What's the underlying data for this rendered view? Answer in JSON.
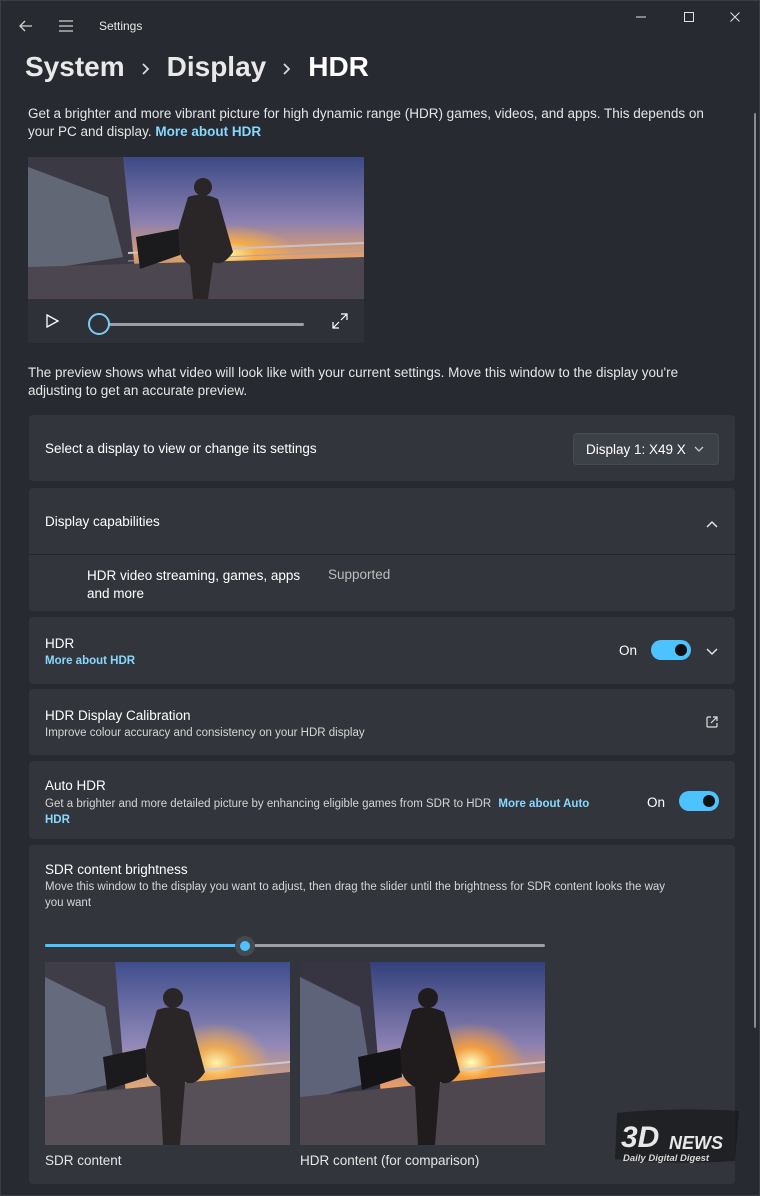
{
  "window": {
    "title": "Settings"
  },
  "breadcrumb": [
    "System",
    "Display",
    "HDR"
  ],
  "intro": {
    "text": "Get a brighter and more vibrant picture for high dynamic range (HDR) games, videos, and apps. This depends on your PC and display.",
    "link": "More about HDR"
  },
  "preview_note": "The preview shows what video will look like with your current settings. Move this window to the display you're adjusting to get an accurate preview.",
  "video": {
    "progress": 0
  },
  "display_select": {
    "label": "Select a display to view or change its settings",
    "value": "Display 1: X49 X"
  },
  "capabilities": {
    "title": "Display capabilities",
    "row_label_line1": "HDR video streaming, games, apps",
    "row_label_line2": "and more",
    "row_value": "Supported"
  },
  "hdr": {
    "title": "HDR",
    "link": "More about HDR",
    "state": "On"
  },
  "calibration": {
    "title": "HDR Display Calibration",
    "subtitle": "Improve colour accuracy and consistency on your HDR display"
  },
  "auto_hdr": {
    "title": "Auto HDR",
    "subtitle": "Get a brighter and more detailed picture by enhancing eligible games from SDR to HDR",
    "link_part1": "More about Auto",
    "link_part2": "HDR",
    "state": "On"
  },
  "sdr_brightness": {
    "title": "SDR content brightness",
    "subtitle_line1": "Move this window to the display you want to adjust, then drag the slider until the brightness for SDR content looks the way",
    "subtitle_line2": "you want",
    "level": 0.4,
    "caption_sdr": "SDR content",
    "caption_hdr": "HDR content (for comparison)"
  },
  "watermark": {
    "brand": "3DNEWS",
    "tagline": "Daily Digital Digest"
  },
  "colors": {
    "accent": "#4cc2ff",
    "link": "#88d7ff",
    "card": "#32363c",
    "background": "#272b31"
  },
  "icons": [
    "back-arrow-icon",
    "hamburger-menu-icon",
    "minimize-icon",
    "maximize-icon",
    "close-icon",
    "chevron-right-icon",
    "play-icon",
    "fullscreen-icon",
    "chevron-down-icon",
    "chevron-up-icon",
    "external-link-icon"
  ]
}
